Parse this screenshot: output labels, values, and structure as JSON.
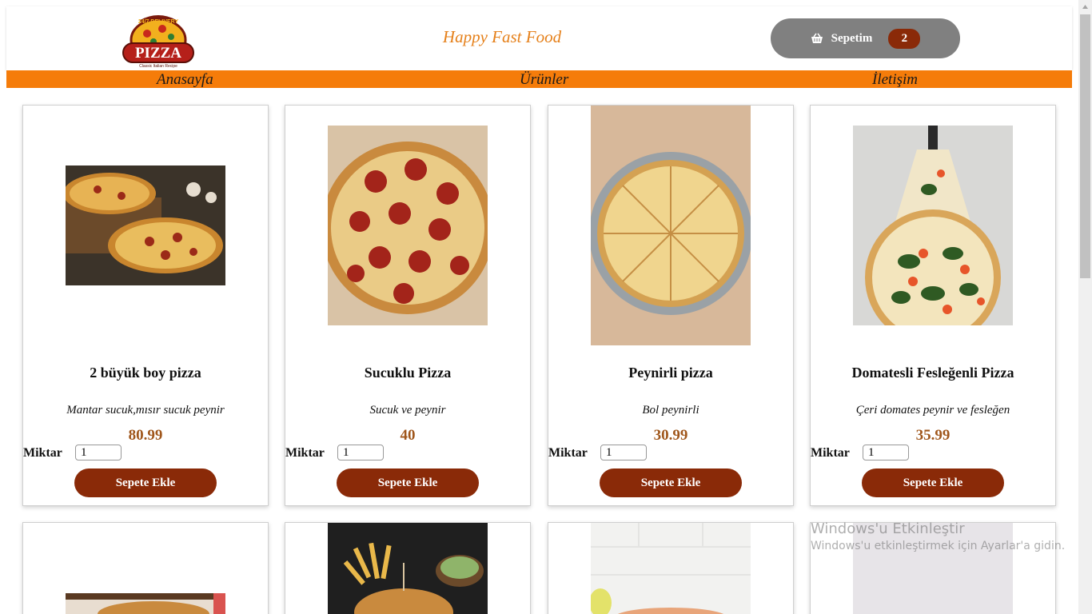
{
  "header": {
    "logo_top_text": "24/7 DELIVERY",
    "logo_main_text": "PIZZA",
    "logo_sub_text": "Classic Italian Recipe",
    "brand": "Happy Fast Food",
    "cart_label": "Sepetim",
    "cart_count": "2",
    "cart_icon": "basket-icon"
  },
  "nav": {
    "items": [
      {
        "label": "Anasayfa"
      },
      {
        "label": "Ürünler"
      },
      {
        "label": "İletişim"
      }
    ]
  },
  "products": [
    {
      "name": "2 büyük boy pizza",
      "desc": "Mantar sucuk,mısır sucuk peynir",
      "price": "80.99",
      "qty_label": "Miktar",
      "qty": "1",
      "button": "Sepete Ekle",
      "image": "two-pizzas-photo"
    },
    {
      "name": "Sucuklu Pizza",
      "desc": "Sucuk ve peynir",
      "price": "40",
      "qty_label": "Miktar",
      "qty": "1",
      "button": "Sepete Ekle",
      "image": "pepperoni-pizza-photo"
    },
    {
      "name": "Peynirli pizza",
      "desc": "Bol peynirli",
      "price": "30.99",
      "qty_label": "Miktar",
      "qty": "1",
      "button": "Sepete Ekle",
      "image": "cheese-pizza-photo"
    },
    {
      "name": "Domatesli Fesleğenli Pizza",
      "desc": "Çeri domates peynir ve fesleğen",
      "price": "35.99",
      "qty_label": "Miktar",
      "qty": "1",
      "button": "Sepete Ekle",
      "image": "tomato-basil-pizza-photo"
    }
  ],
  "row2_images": [
    "burger-photo",
    "burger-fries-photo",
    "dish-photo",
    "drink-photo"
  ],
  "watermark": {
    "title": "Windows'u Etkinleştir",
    "subtitle": "Windows'u etkinleştirmek için Ayarlar'a gidin."
  },
  "colors": {
    "accent_orange": "#f57c0a",
    "brand_text": "#e5801a",
    "button_brown": "#8a2a08",
    "price": "#a0571c",
    "cart_bg": "#808080"
  }
}
